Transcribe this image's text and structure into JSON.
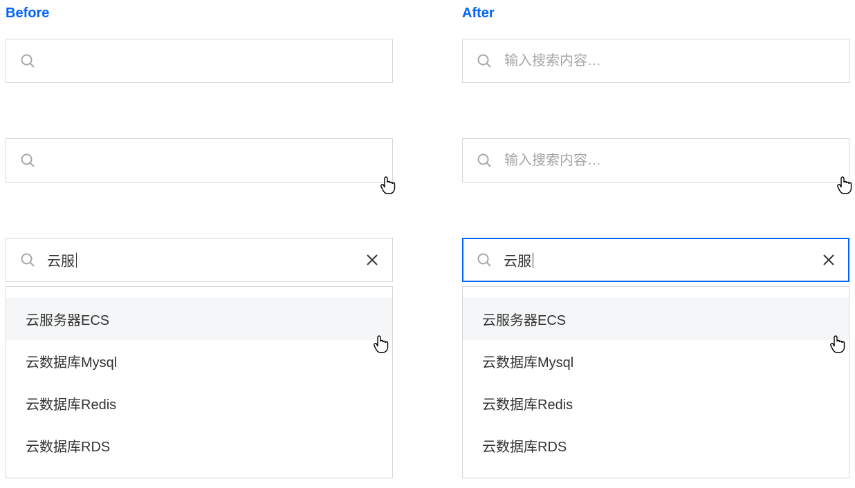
{
  "before": {
    "label": "Before",
    "placeholder_empty": "",
    "typed_value": "云服",
    "suggestions": [
      "云服务器ECS",
      "云数据库Mysql",
      "云数据库Redis",
      "云数据库RDS"
    ]
  },
  "after": {
    "label": "After",
    "placeholder": "输入搜索内容…",
    "typed_value": "云服",
    "suggestions": [
      "云服务器ECS",
      "云数据库Mysql",
      "云数据库Redis",
      "云数据库RDS"
    ]
  }
}
